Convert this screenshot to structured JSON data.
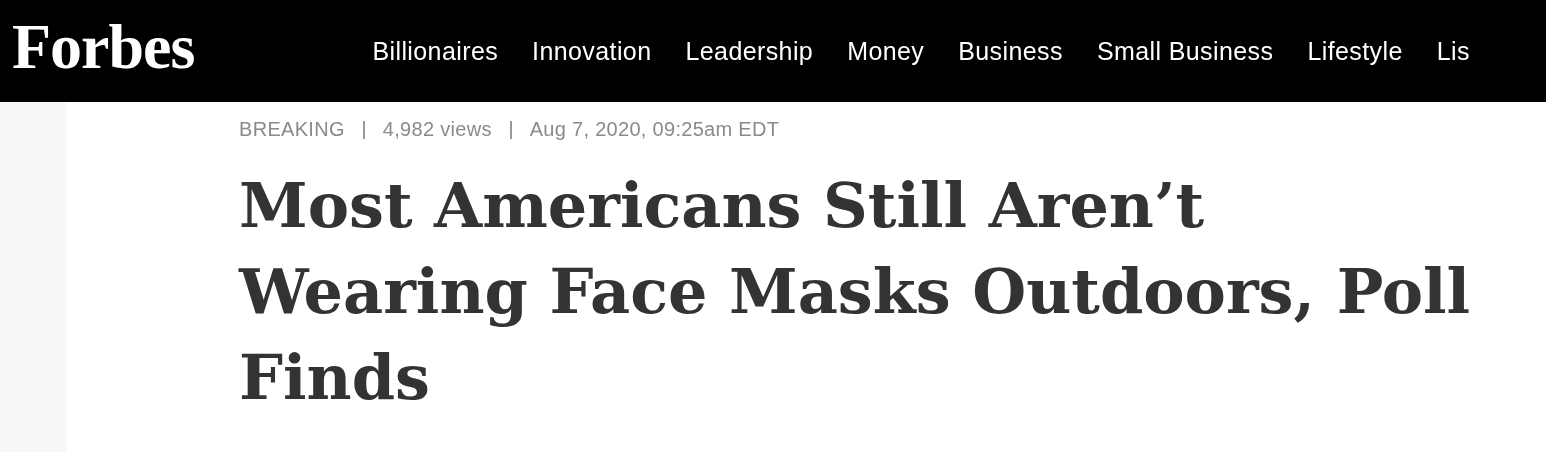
{
  "header": {
    "logo": "Forbes",
    "nav": [
      {
        "label": "Billionaires"
      },
      {
        "label": "Innovation"
      },
      {
        "label": "Leadership"
      },
      {
        "label": "Money"
      },
      {
        "label": "Business"
      },
      {
        "label": "Small Business"
      },
      {
        "label": "Lifestyle"
      },
      {
        "label": "Lis"
      }
    ]
  },
  "article": {
    "meta": [
      "BREAKING",
      "4,982 views",
      "Aug 7, 2020, 09:25am EDT"
    ],
    "headline": "Most Americans Still Aren’t Wearing Face Masks Outdoors, Poll Finds"
  }
}
